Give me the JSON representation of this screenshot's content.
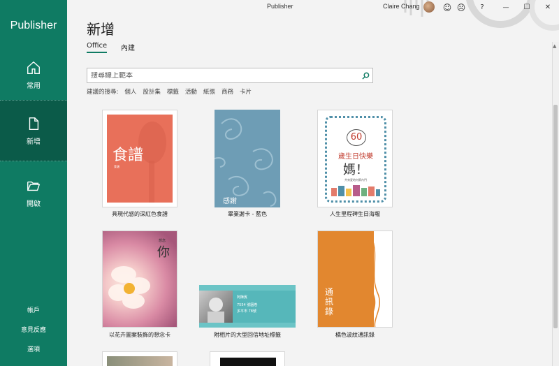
{
  "app": {
    "name": "Publisher",
    "window_title": "Publisher"
  },
  "user": {
    "name": "Claire Chang"
  },
  "titlebar": {
    "smile": "☺",
    "frown": "☹",
    "help": "?",
    "minimize": "—",
    "maximize": "☐",
    "close": "✕"
  },
  "sidebar": {
    "items": [
      {
        "label": "常用"
      },
      {
        "label": "新增"
      },
      {
        "label": "開啟"
      }
    ],
    "bottom": [
      {
        "label": "帳戶"
      },
      {
        "label": "意見反應"
      },
      {
        "label": "選項"
      }
    ]
  },
  "main": {
    "title": "新增",
    "tabs": [
      {
        "label": "Office"
      },
      {
        "label": "內建"
      }
    ],
    "search": {
      "placeholder": "搜尋線上範本"
    },
    "suggested": {
      "label": "建議的搜尋:",
      "links": [
        "個人",
        "設計集",
        "標籤",
        "活動",
        "紙張",
        "商務",
        "卡片"
      ]
    },
    "templates": [
      {
        "caption": "具現代感的深紅色食譜",
        "text": "食譜",
        "small": "食譜"
      },
      {
        "caption": "畢業謝卡 - 藍色",
        "text": "感謝"
      },
      {
        "caption": "人生里程碑生日海報",
        "number": "60",
        "line1": "歲生日快樂",
        "line2": "媽！",
        "line3": "共來愛地何節內門"
      },
      {
        "caption": "以花卉圖案裝飾的想念卡",
        "text": "你",
        "small": "想念"
      },
      {
        "caption": "附相片的大型回信地址標籤",
        "line1": "阿陳賓",
        "line2": "7554 號園卷",
        "line3": "多平市 78號"
      },
      {
        "caption": "橘色波紋通訊錄",
        "text": "通訊錄"
      }
    ]
  },
  "colors": {
    "accent": "#0f7b63",
    "sidebar_active": "#0b5b49"
  }
}
